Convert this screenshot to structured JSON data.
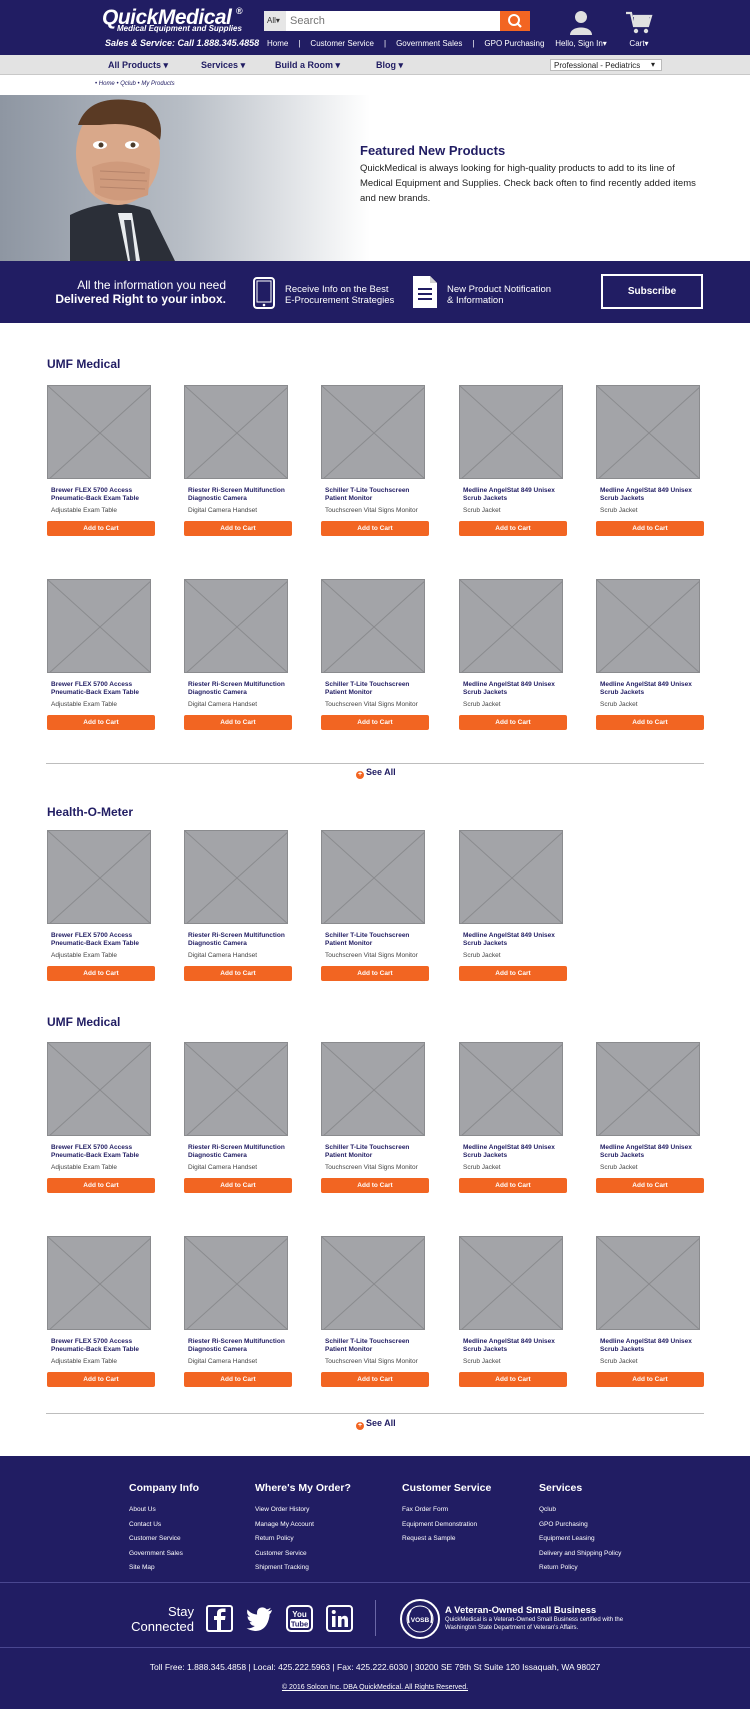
{
  "header": {
    "logo": "QuickMedical",
    "logo_sub": "Medical Equipment and Supplies",
    "sales_line": "Sales & Service: Call 1.888.345.4858",
    "search_category": "All",
    "search_placeholder": "Search",
    "top_links": [
      "Home",
      "Customer Service",
      "Government Sales",
      "GPO Purchasing"
    ],
    "account_label": "Hello, Sign In",
    "cart_label": "Cart"
  },
  "nav": {
    "items": [
      "All Products",
      "Services",
      "Build a Room",
      "Blog"
    ],
    "profile": "Professional - Pediatrics"
  },
  "breadcrumb": "• Home • Qclub • My Products",
  "hero": {
    "title": "Featured New Products",
    "text": "QuickMedical is always looking for high-quality products to add to its line of Medical Equipment and Supplies. Check back often to find recently added items and new brands."
  },
  "newsletter": {
    "line1": "All the information you need",
    "line2": "Delivered Right to your inbox.",
    "item1": [
      "Receive Info on the Best",
      "E-Procurement Strategies"
    ],
    "item2": [
      "New Product Notification",
      "& Information"
    ],
    "subscribe_label": "Subscribe"
  },
  "products": [
    {
      "name": "Brewer FLEX 5700 Access Pneumatic-Back Exam Table",
      "sub": "Adjustable Exam Table"
    },
    {
      "name": "Riester Ri-Screen Multifunction Diagnostic Camera",
      "sub": "Digital Camera Handset"
    },
    {
      "name": "Schiller T-Lite Touchscreen Patient Monitor",
      "sub": "Touchscreen Vital Signs Monitor"
    },
    {
      "name": "Medline AngelStat 849 Unisex Scrub Jackets",
      "sub": "Scrub Jacket"
    },
    {
      "name": "Medline AngelStat 849 Unisex Scrub Jackets",
      "sub": "Scrub Jacket"
    }
  ],
  "add_to_cart_label": "Add to Cart",
  "sections": [
    {
      "title": "UMF Medical"
    },
    {
      "title": "Health-O-Meter"
    },
    {
      "title": "UMF Medical"
    }
  ],
  "see_all_label": "See All",
  "footer": {
    "columns": [
      {
        "heading": "Company Info",
        "links": [
          "About Us",
          "Contact Us",
          "Customer Service",
          "Government Sales",
          "Site Map"
        ]
      },
      {
        "heading": "Where's My Order?",
        "links": [
          "View Order History",
          "Manage My Account",
          "Return Policy",
          "Customer Service",
          "Shipment Tracking"
        ]
      },
      {
        "heading": "Customer Service",
        "links": [
          "Fax Order Form",
          "Equipment Demonstration",
          "Request a Sample"
        ]
      },
      {
        "heading": "Services",
        "links": [
          "Qclub",
          "GPO Purchasing",
          "Equipment Leasing",
          "Delivery and Shipping Policy",
          "Return Policy"
        ]
      }
    ],
    "stay_connected": [
      "Stay",
      "Connected"
    ],
    "vosb_badge": "VOSB",
    "vosb_title": "A Veteran-Owned Small Business",
    "vosb_text": "QuickMedical is a Veteran-Owned Small Business certified with the Washington State Department of Veteran's Affairs.",
    "contact": "Toll Free: 1.888.345.4858   |   Local: 425.222.5963   |   Fax: 425.222.6030   |   30200 SE 79th St Suite 120 Issaquah, WA 98027",
    "copyright": "© 2016 Solcon Inc. DBA QuickMedical. All Rights Reserved."
  },
  "colors": {
    "navy": "#211d63",
    "orange": "#f26522",
    "placeholder": "#a3a4a8"
  }
}
